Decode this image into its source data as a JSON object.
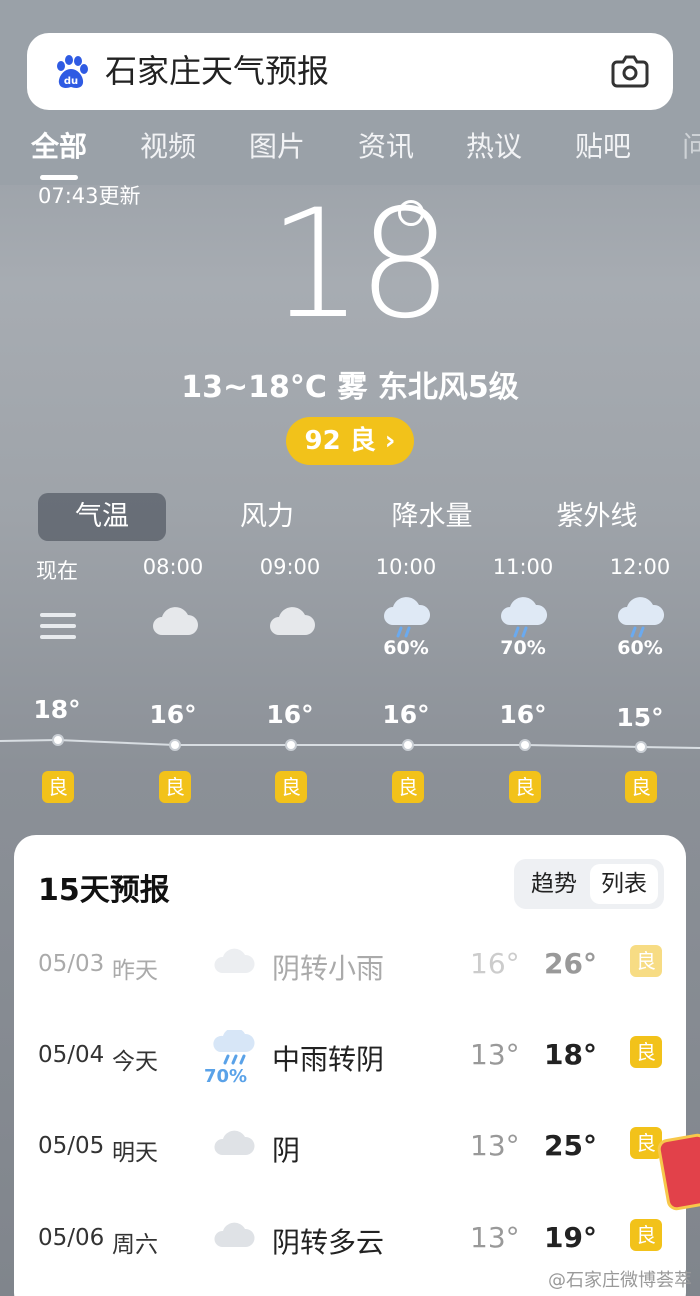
{
  "search": {
    "query": "石家庄天气预报"
  },
  "tabs": [
    "全部",
    "视频",
    "图片",
    "资讯",
    "热议",
    "贴吧",
    "问"
  ],
  "hero": {
    "updated": "07:43更新",
    "temperature": "18",
    "summary": "13~18°C 雾 东北风5级",
    "aqi": "92 良 ›"
  },
  "metric_tabs": [
    "气温",
    "风力",
    "降水量",
    "紫外线"
  ],
  "hourly": [
    {
      "time": "现在",
      "icon": "fog-icon",
      "pop": "",
      "temp": "18°",
      "aqi": "良"
    },
    {
      "time": "08:00",
      "icon": "cloud-icon",
      "pop": "",
      "temp": "16°",
      "aqi": "良"
    },
    {
      "time": "09:00",
      "icon": "cloud-icon",
      "pop": "",
      "temp": "16°",
      "aqi": "良"
    },
    {
      "time": "10:00",
      "icon": "rain-cloud-icon",
      "pop": "60%",
      "temp": "16°",
      "aqi": "良"
    },
    {
      "time": "11:00",
      "icon": "rain-cloud-icon",
      "pop": "70%",
      "temp": "16°",
      "aqi": "良"
    },
    {
      "time": "12:00",
      "icon": "rain-cloud-icon",
      "pop": "60%",
      "temp": "15°",
      "aqi": "良"
    }
  ],
  "forecast": {
    "title": "15天预报",
    "toggle": [
      "趋势",
      "列表"
    ],
    "rows": [
      {
        "date": "05/03",
        "day": "昨天",
        "icon": "cloud-icon",
        "pop": "",
        "desc": "阴转小雨",
        "low": "16°",
        "high": "26°",
        "aqi": "良"
      },
      {
        "date": "05/04",
        "day": "今天",
        "icon": "rain-cloud-icon",
        "pop": "70%",
        "desc": "中雨转阴",
        "low": "13°",
        "high": "18°",
        "aqi": "良"
      },
      {
        "date": "05/05",
        "day": "明天",
        "icon": "cloud-icon",
        "pop": "",
        "desc": "阴",
        "low": "13°",
        "high": "25°",
        "aqi": "良"
      },
      {
        "date": "05/06",
        "day": "周六",
        "icon": "cloud-icon",
        "pop": "",
        "desc": "阴转多云",
        "low": "13°",
        "high": "19°",
        "aqi": "良"
      }
    ]
  },
  "watermark": "@石家庄微博荟萃",
  "colors": {
    "aqi_good": "#f2c21a",
    "accent_blue": "#5aa2e8"
  }
}
